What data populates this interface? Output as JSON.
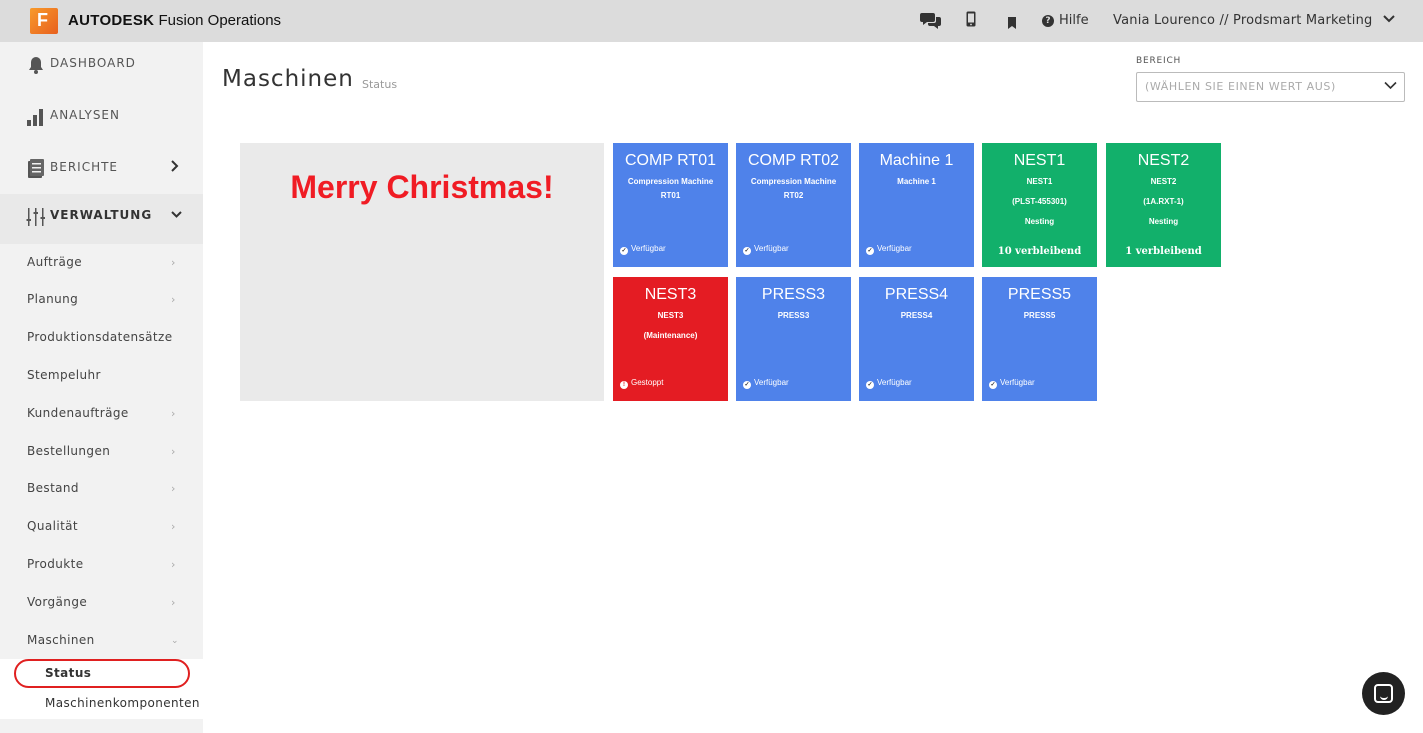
{
  "topbar": {
    "logo_letter": "F",
    "brand_bold": "AUTODESK",
    "brand_rest": " Fusion Operations",
    "icons": [
      "chat-icon",
      "mobile-icon",
      "bookmark-icon",
      "help-icon"
    ],
    "help_label": "Hilfe",
    "user": "Vania Lourenco // Prodsmart Marketing"
  },
  "sidebar": {
    "main": [
      {
        "label": "DASHBOARD",
        "icon": "bell-icon"
      },
      {
        "label": "ANALYSEN",
        "icon": "bar-chart-icon"
      },
      {
        "label": "BERICHTE",
        "icon": "report-icon"
      },
      {
        "label": "VERWALTUNG",
        "icon": "sliders-icon"
      }
    ],
    "sub": [
      "Aufträge",
      "Planung",
      "Produktionsdatensätze",
      "Stempeluhr",
      "Kundenaufträge",
      "Bestellungen",
      "Bestand",
      "Qualität",
      "Produkte",
      "Vorgänge",
      "Maschinen"
    ],
    "machines_sub": [
      "Status",
      "Maschinenkomponenten"
    ]
  },
  "main": {
    "title": "Maschinen",
    "subtitle": "Status",
    "bereich_label": "BEREICH",
    "bereich_placeholder": "(WÄHLEN SIE EINEN WERT AUS)",
    "banner": "Merry Christmas!",
    "tiles": [
      {
        "name": "COMP RT01",
        "lines": [
          "Compression Machine",
          "RT01"
        ],
        "status": "Verfügbar",
        "color": "#4f82ea"
      },
      {
        "name": "COMP RT02",
        "lines": [
          "Compression Machine",
          "RT02"
        ],
        "status": "Verfügbar",
        "color": "#4f82ea"
      },
      {
        "name": "Machine 1",
        "lines": [
          "Machine 1"
        ],
        "status": "Verfügbar",
        "color": "#4f82ea"
      },
      {
        "name": "NEST1",
        "lines": [
          "NEST1",
          "(PLST-455301)",
          "Nesting"
        ],
        "remaining": "10 verbleibend",
        "color": "#12b06b"
      },
      {
        "name": "NEST2",
        "lines": [
          "NEST2",
          "(1A.RXT-1)",
          "Nesting"
        ],
        "remaining": "1 verbleibend",
        "color": "#12b06b"
      },
      {
        "name": "NEST3",
        "lines": [
          "NEST3",
          "(Maintenance)"
        ],
        "status": "Gestoppt",
        "color": "#e41c23"
      },
      {
        "name": "PRESS3",
        "lines": [
          "PRESS3"
        ],
        "status": "Verfügbar",
        "color": "#4f82ea"
      },
      {
        "name": "PRESS4",
        "lines": [
          "PRESS4"
        ],
        "status": "Verfügbar",
        "color": "#4f82ea"
      },
      {
        "name": "PRESS5",
        "lines": [
          "PRESS5"
        ],
        "status": "Verfügbar",
        "color": "#4f82ea"
      }
    ]
  }
}
